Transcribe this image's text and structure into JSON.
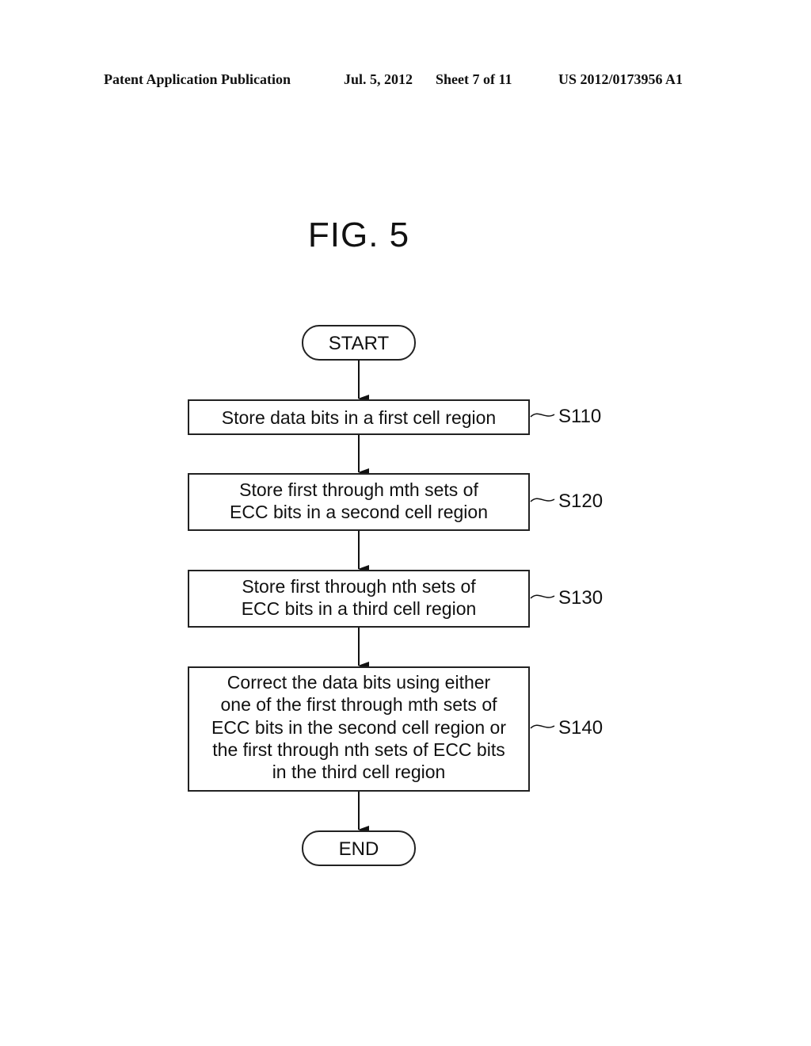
{
  "header": {
    "publication_type": "Patent Application Publication",
    "date": "Jul. 5, 2012",
    "sheet": "Sheet 7 of 11",
    "publication_number": "US 2012/0173956 A1"
  },
  "figure": {
    "title": "FIG. 5"
  },
  "flowchart": {
    "start": "START",
    "end": "END",
    "steps": [
      {
        "ref": "S110",
        "lines": [
          "Store data bits in a first cell region"
        ]
      },
      {
        "ref": "S120",
        "lines": [
          "Store first through mth sets of",
          "ECC bits in a second cell region"
        ]
      },
      {
        "ref": "S130",
        "lines": [
          "Store first through nth sets of",
          "ECC bits in a third cell region"
        ]
      },
      {
        "ref": "S140",
        "lines": [
          "Correct the data bits using either",
          "one of the first through mth sets of",
          "ECC bits in the second cell region or",
          "the first through nth sets of ECC bits",
          "in the third cell region"
        ]
      }
    ]
  }
}
